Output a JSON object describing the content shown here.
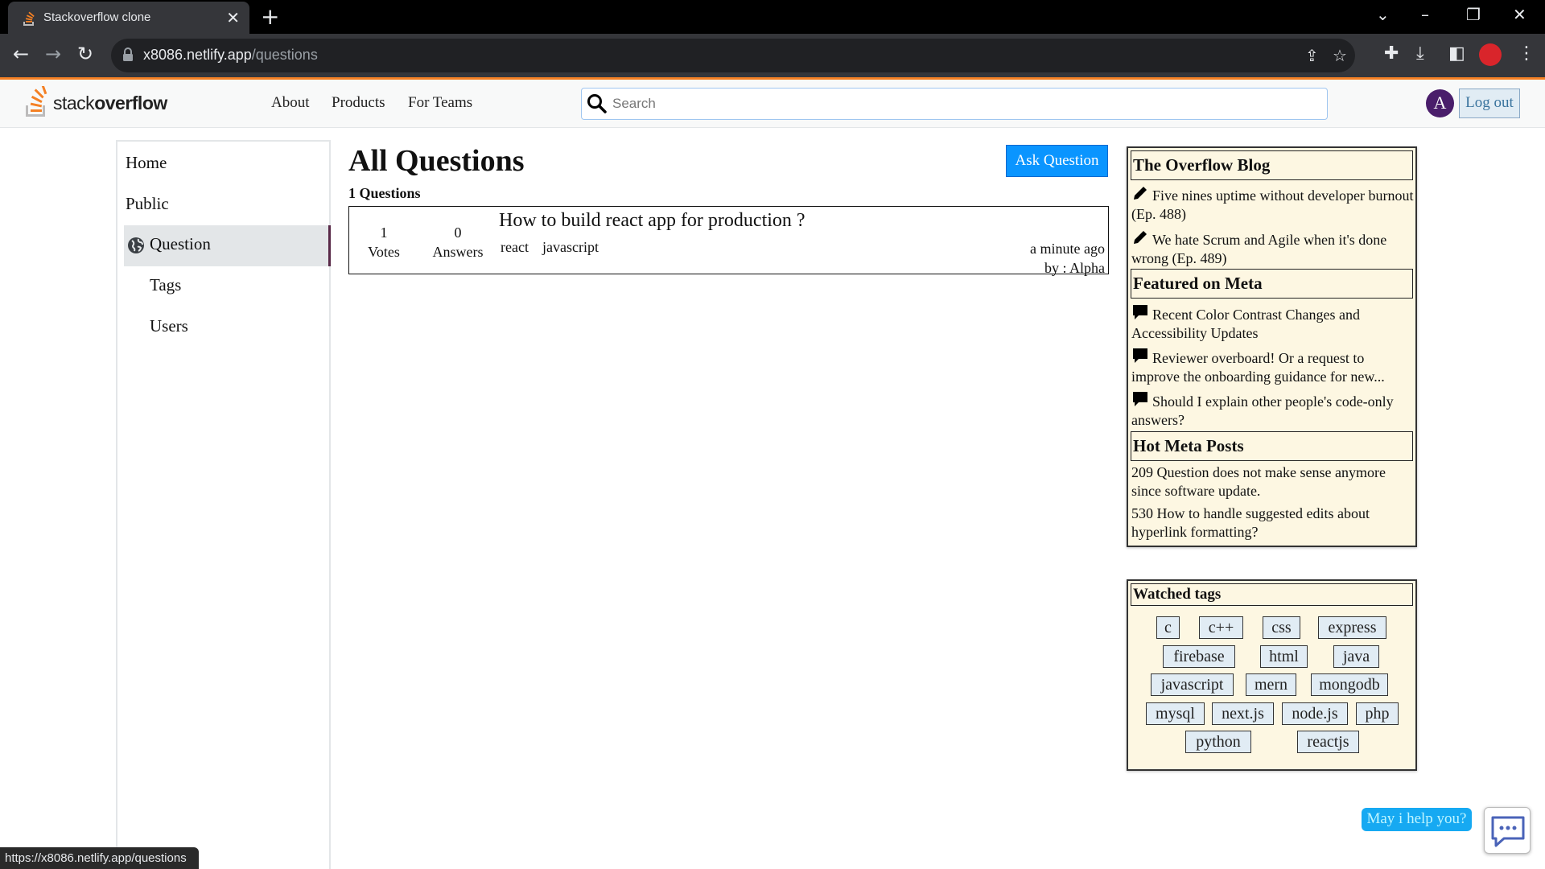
{
  "browser": {
    "tab_title": "Stackoverflow clone",
    "new_tab": "+",
    "close_tab": "✕",
    "url_host": "x8086.netlify.app",
    "url_path": "/questions",
    "status_url": "https://x8086.netlify.app/questions"
  },
  "header": {
    "logo_light": "stack",
    "logo_bold": "overflow",
    "nav": [
      "About",
      "Products",
      "For Teams"
    ],
    "search_placeholder": "Search",
    "avatar_letter": "A",
    "logout_label": "Log out"
  },
  "sidebar": {
    "items": [
      "Home",
      "Public",
      "Question",
      "Tags",
      "Users"
    ]
  },
  "main": {
    "title": "All Questions",
    "ask_label": "Ask Question",
    "count_label": "1 Questions",
    "questions": [
      {
        "votes": "1",
        "votes_label": "Votes",
        "answers": "0",
        "answers_label": "Answers",
        "title": "How to build react app for production ?",
        "tags": [
          "react",
          "javascript"
        ],
        "time": "a minute ago",
        "author": "by : Alpha"
      }
    ]
  },
  "widget": {
    "blog_heading": "The Overflow Blog",
    "blog_items": [
      "Five nines uptime without developer burnout (Ep. 488)",
      "We hate Scrum and Agile when it's done wrong (Ep. 489)"
    ],
    "meta_heading": "Featured on Meta",
    "meta_items": [
      "Recent Color Contrast Changes and Accessibility Updates",
      "Reviewer overboard! Or a request to improve the onboarding guidance for new...",
      "Should I explain other people's code-only answers?"
    ],
    "hot_heading": "Hot Meta Posts",
    "hot_items": [
      "209 Question does not make sense anymore since software update.",
      "530 How to handle suggested edits about hyperlink formatting?"
    ]
  },
  "watched": {
    "heading": "Watched tags",
    "tags": [
      "c",
      "c++",
      "css",
      "express",
      "firebase",
      "html",
      "java",
      "javascript",
      "mern",
      "mongodb",
      "mysql",
      "next.js",
      "node.js",
      "php",
      "python",
      "reactjs"
    ]
  },
  "chat": {
    "bubble": "May i help you?"
  },
  "colors": {
    "accent_orange": "#f48024",
    "ask_blue": "#0a95ff",
    "widget_bg": "#fdf7e2",
    "tag_bg": "#e1ecf4",
    "chat_blue": "#16a9f2"
  }
}
